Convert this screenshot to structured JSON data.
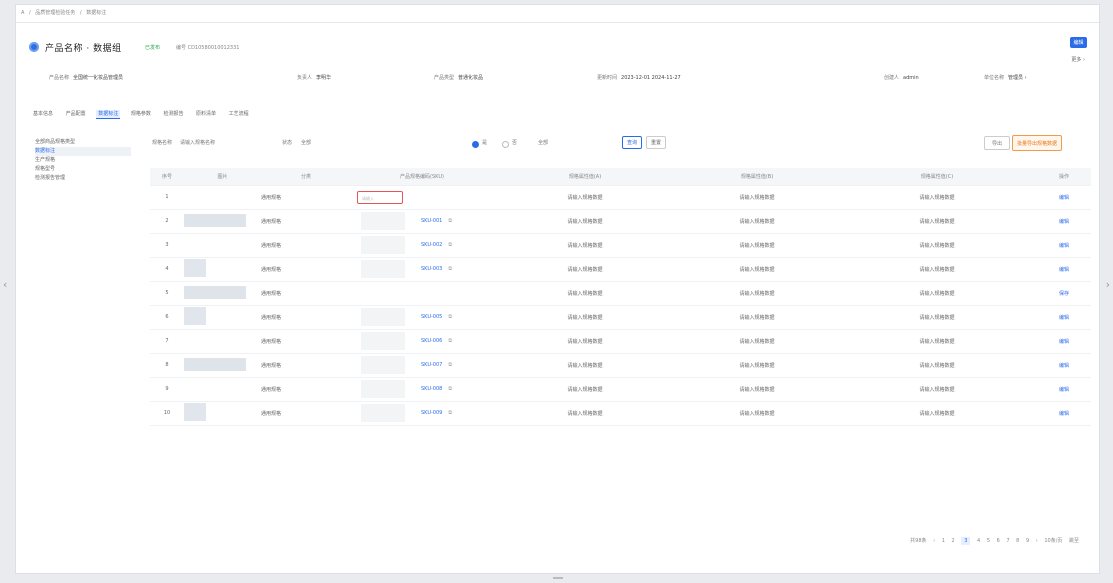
{
  "breadcrumb": [
    "A",
    "/",
    "品质管理检验任务",
    "/",
    "数据标注"
  ],
  "product": {
    "title": "产品名称 · 数据组",
    "status": "已发布",
    "code": "编号 CD10580010012331"
  },
  "header_buttons": {
    "primary": "编辑",
    "more": "更多 ›"
  },
  "info": [
    {
      "label": "产品名称",
      "value": "全国统一化妆品管理员"
    },
    {
      "label": "负责人",
      "value": "李明华"
    },
    {
      "label": "产品类型",
      "value": "普通化妆品"
    },
    {
      "label": "更新时间",
      "value": "2023-12-01 2024-11-27"
    },
    {
      "label": "创建人",
      "value": "admin"
    },
    {
      "label": "单位名称",
      "value": "管理员 ›"
    }
  ],
  "tabs": [
    "基本信息",
    "产品配置",
    "数据标注",
    "规格参数",
    "检测报告",
    "原料清单",
    "工艺流程"
  ],
  "active_tab": 2,
  "tree": [
    "全部商品规格类型",
    "数据标注",
    "生产规格",
    "规格型号",
    "检测报告管理"
  ],
  "tree_selected": 1,
  "filters": {
    "f1_label": "规格名称",
    "f1_value": "请输入规格名称",
    "f2_label": "状态",
    "f2_value": "全部",
    "r1_label": "是",
    "r2_label": "否",
    "f3_value": "全部",
    "search": "查询",
    "reset": "重置",
    "export": "导出",
    "batch": "批量导出规格数据"
  },
  "table": {
    "headers": [
      "序号",
      "图片",
      "分类",
      "产品规格编码(SKU)",
      "规格属性值(A)",
      "规格属性值(B)",
      "规格属性值(C)",
      "操作"
    ],
    "rows": [
      {
        "idx": "1",
        "cat": "通用规格",
        "sku": "请输入",
        "a": "请输入规格数据",
        "b": "请输入规格数据",
        "c": "请输入规格数据",
        "act": "编辑",
        "type": "input"
      },
      {
        "idx": "2",
        "cat": "通用规格",
        "sku": "SKU-001",
        "a": "请输入规格数据",
        "b": "请输入规格数据",
        "c": "请输入规格数据",
        "act": "编辑",
        "type": "link"
      },
      {
        "idx": "3",
        "cat": "通用规格",
        "sku": "SKU-002",
        "a": "请输入规格数据",
        "b": "请输入规格数据",
        "c": "请输入规格数据",
        "act": "编辑",
        "type": "link"
      },
      {
        "idx": "4",
        "cat": "通用规格",
        "sku": "SKU-003",
        "a": "请输入规格数据",
        "b": "请输入规格数据",
        "c": "请输入规格数据",
        "act": "编辑",
        "type": "link"
      },
      {
        "idx": "5",
        "cat": "通用规格",
        "sku": "",
        "a": "请输入规格数据",
        "b": "请输入规格数据",
        "c": "请输入规格数据",
        "act": "保存",
        "type": "none"
      },
      {
        "idx": "6",
        "cat": "通用规格",
        "sku": "SKU-005",
        "a": "请输入规格数据",
        "b": "请输入规格数据",
        "c": "请输入规格数据",
        "act": "编辑",
        "type": "link"
      },
      {
        "idx": "7",
        "cat": "通用规格",
        "sku": "SKU-006",
        "a": "请输入规格数据",
        "b": "请输入规格数据",
        "c": "请输入规格数据",
        "act": "编辑",
        "type": "link"
      },
      {
        "idx": "8",
        "cat": "通用规格",
        "sku": "SKU-007",
        "a": "请输入规格数据",
        "b": "请输入规格数据",
        "c": "请输入规格数据",
        "act": "编辑",
        "type": "link"
      },
      {
        "idx": "9",
        "cat": "通用规格",
        "sku": "SKU-008",
        "a": "请输入规格数据",
        "b": "请输入规格数据",
        "c": "请输入规格数据",
        "act": "编辑",
        "type": "link"
      },
      {
        "idx": "10",
        "cat": "通用规格",
        "sku": "SKU-009",
        "a": "请输入规格数据",
        "b": "请输入规格数据",
        "c": "请输入规格数据",
        "act": "编辑",
        "type": "link"
      }
    ]
  },
  "pager": {
    "total": "共98条",
    "prev": "‹",
    "pages": [
      "1",
      "2",
      "3",
      "4",
      "5",
      "6",
      "7",
      "8",
      "9"
    ],
    "current": 3,
    "next": "›",
    "size": "10条/页",
    "jump": "跳至"
  },
  "icons": {
    "side_left": "chevron-left-icon",
    "side_right": "chevron-right-icon",
    "help": "info-icon"
  }
}
